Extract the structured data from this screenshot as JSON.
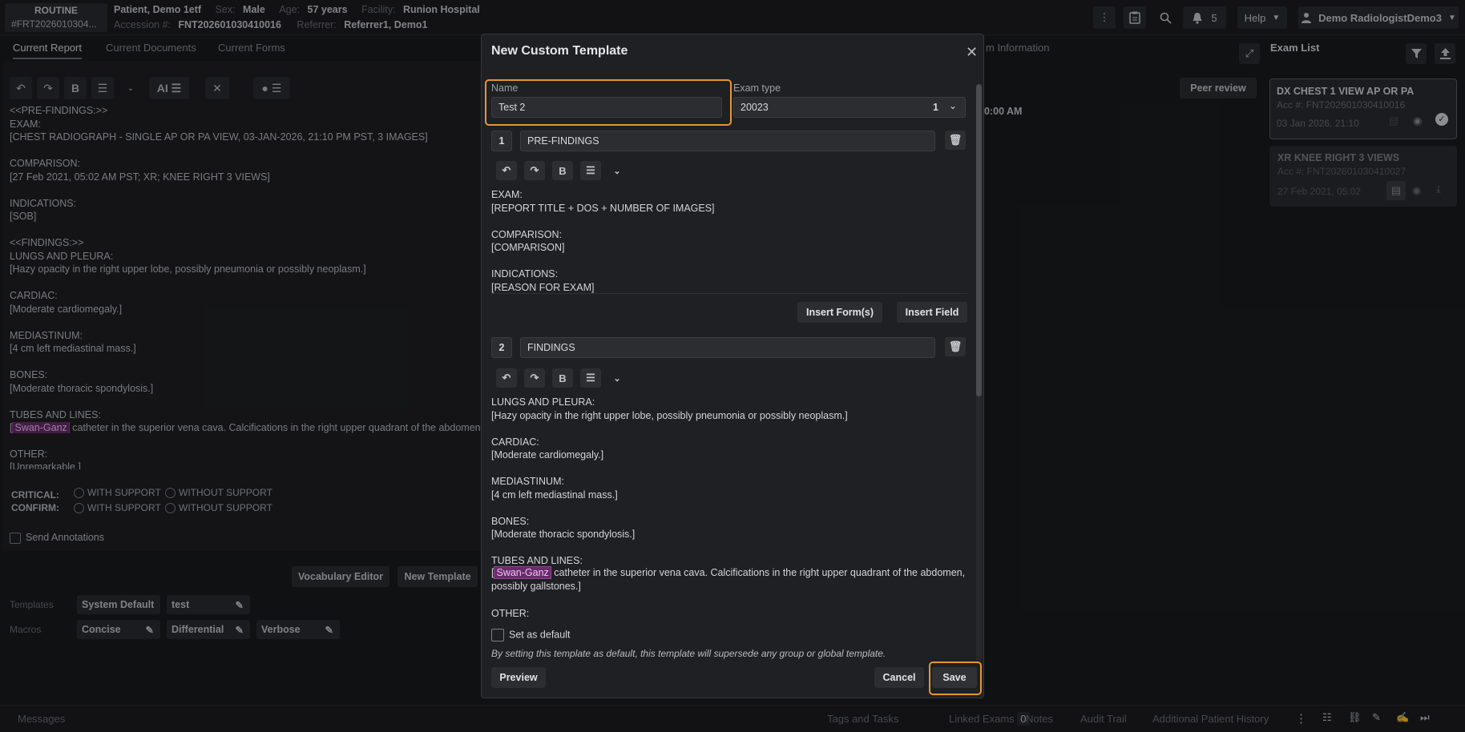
{
  "header": {
    "priority": "ROUTINE",
    "order_id": "#FRT2026010304...",
    "patient_name": "Patient, Demo 1etf",
    "sex_label": "Sex:",
    "sex": "Male",
    "age_label": "Age:",
    "age": "57 years",
    "facility_label": "Facility:",
    "facility": "Runion Hospital",
    "accession_label": "Accession #:",
    "accession": "FNT202601030410016",
    "referrer_label": "Referrer:",
    "referrer": "Referrer1, Demo1",
    "notifications_count": "5",
    "help_label": "Help",
    "user_name": "Demo RadiologistDemo3"
  },
  "tabs": {
    "current_report": "Current Report",
    "current_documents": "Current Documents",
    "current_forms": "Current Forms",
    "exam_information": "m Information",
    "exam_list": "Exam List"
  },
  "report": {
    "peer_review": "Peer review",
    "time_fragment": "0:00 AM",
    "text": "<<PRE-FINDINGS:>>\nEXAM:\n[CHEST RADIOGRAPH - SINGLE AP OR PA VIEW, 03-JAN-2026, 21:10 PM PST, 3 IMAGES]\n\nCOMPARISON:\n[27 Feb 2021, 05:02 AM PST; XR; KNEE RIGHT 3 VIEWS]\n\nINDICATIONS:\n[SOB]\n\n<<FINDINGS:>>\nLUNGS AND PLEURA:\n[Hazy opacity in the right upper lobe, possibly pneumonia or possibly neoplasm.]\n\nCARDIAC:\n[Moderate cardiomegaly.]\n\nMEDIASTINUM:\n[4 cm left mediastinal mass.]\n\nBONES:\n[Moderate thoracic spondylosis.]\n\nTUBES AND LINES:",
    "tubes_hl": "Swan-Ganz",
    "tubes_rest": " catheter in the superior vena cava. Calcifications in the right upper quadrant of the abdomen,",
    "other_label": "OTHER:",
    "other_value": "[Unremarkable.]",
    "critical_label": "CRITICAL:",
    "confirm_label": "CONFIRM:",
    "with_support": "WITH SUPPORT",
    "without_support": "WITHOUT SUPPORT",
    "send_annotations": "Send Annotations"
  },
  "bottom_left": {
    "vocabulary_editor": "Vocabulary Editor",
    "new_template": "New Template",
    "templates_label": "Templates",
    "macros_label": "Macros",
    "templates": [
      "System Default",
      "test"
    ],
    "macros": [
      "Concise",
      "Differential",
      "Verbose"
    ]
  },
  "exam_list": [
    {
      "title": "DX CHEST 1 VIEW AP OR PA",
      "acc": "Acc #: FNT202601030410016",
      "date": "03 Jan 2026, 21:10"
    },
    {
      "title": "XR KNEE RIGHT 3 VIEWS",
      "acc": "Acc #: FNT202601030410027",
      "date": "27 Feb 2021, 05:02"
    }
  ],
  "bottombar": {
    "messages": "Messages",
    "tags": "Tags and Tasks",
    "linked": "Linked Exams",
    "linked_count": "0",
    "notes": "Notes",
    "audit": "Audit Trail",
    "history": "Additional Patient History"
  },
  "modal": {
    "title": "New Custom Template",
    "name_label": "Name",
    "name_value": "Test 2",
    "exam_type_label": "Exam type",
    "exam_type_value": "20023",
    "exam_type_count": "1",
    "sections": [
      {
        "num": "1",
        "name": "PRE-FINDINGS",
        "text": "EXAM:\n[REPORT TITLE + DOS + NUMBER OF IMAGES]\n\nCOMPARISON:\n[COMPARISON]\n\nINDICATIONS:\n[REASON FOR EXAM]"
      },
      {
        "num": "2",
        "name": "FINDINGS",
        "text": "LUNGS AND PLEURA:\n[Hazy opacity in the right upper lobe, possibly pneumonia or possibly neoplasm.]\n\nCARDIAC:\n[Moderate cardiomegaly.]\n\nMEDIASTINUM:\n[4 cm left mediastinal mass.]\n\nBONES:\n[Moderate thoracic spondylosis.]\n\nTUBES AND LINES:"
      }
    ],
    "tubes_hl": "Swan-Ganz",
    "tubes_rest": " catheter in the superior vena cava. Calcifications in the right upper quadrant of the abdomen,",
    "tubes_rest2": "possibly gallstones.]",
    "other": "OTHER:",
    "insert_forms": "Insert Form(s)",
    "insert_field": "Insert Field",
    "set_default": "Set as default",
    "default_note": "By setting this template as default, this template will supersede any group or global template.",
    "preview": "Preview",
    "cancel": "Cancel",
    "save": "Save"
  }
}
